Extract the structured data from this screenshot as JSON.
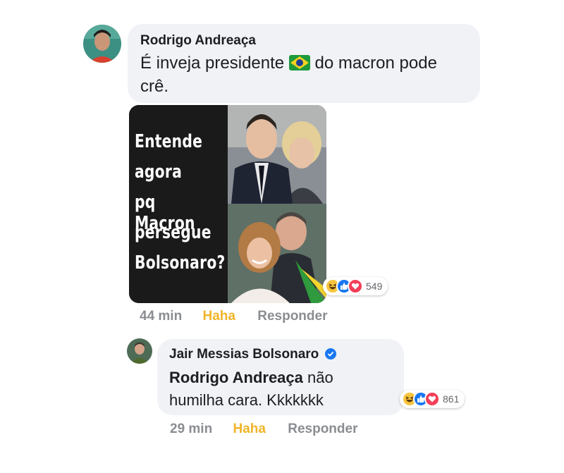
{
  "comment1": {
    "author": "Rodrigo Andreaça",
    "text_before_flag": "É inveja presidente ",
    "flag_icon": "brazil-flag-icon",
    "text_after_flag": " do macron pode",
    "text_line2": "crê.",
    "time": "44 min",
    "reaction_label": "Haha",
    "reply_label": "Responder",
    "reaction_count": "549",
    "reaction_icons": [
      "haha-icon",
      "like-icon",
      "love-icon"
    ]
  },
  "meme": {
    "line1": "Entende",
    "line2": "agora",
    "line3": "pq Macron",
    "line4": "persegue",
    "line5": "Bolsonaro?"
  },
  "comment2": {
    "author": "Jair Messias Bolsonaro",
    "verified_icon": "verified-badge-icon",
    "mention": "Rodrigo Andreaça",
    "text_after_mention": " não",
    "text_line2": "humilha cara. Kkkkkkk",
    "time": "29 min",
    "reaction_label": "Haha",
    "reply_label": "Responder",
    "reaction_count": "861",
    "reaction_icons": [
      "haha-icon",
      "like-icon",
      "love-icon"
    ]
  },
  "colors": {
    "bubble": "#f0f2f5",
    "meta_gray": "#8a8d91",
    "haha_yellow": "#f0b429",
    "like_blue": "#1877f2",
    "love_red": "#f33e58",
    "verified_blue": "#1877f2"
  }
}
